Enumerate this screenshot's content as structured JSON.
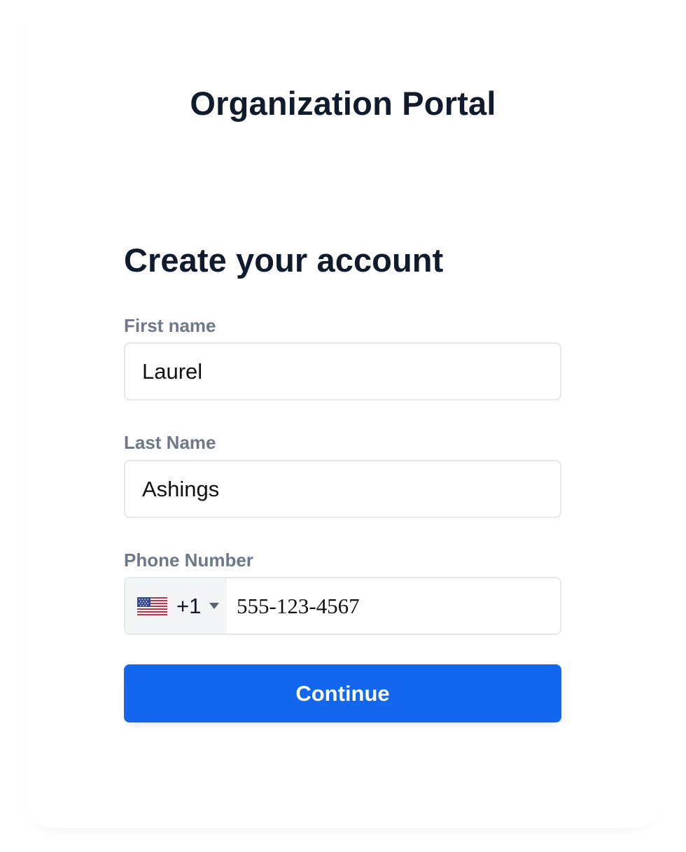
{
  "header": {
    "title": "Organization Portal"
  },
  "form": {
    "heading": "Create your account",
    "first_name": {
      "label": "First name",
      "value": "Laurel"
    },
    "last_name": {
      "label": "Last Name",
      "value": "Ashings"
    },
    "phone": {
      "label": "Phone Number",
      "country_icon": "us-flag-icon",
      "dial_code": "+1",
      "value": "555-123-4567"
    },
    "continue_label": "Continue"
  },
  "colors": {
    "primary": "#1366ee",
    "heading_text": "#101b2e",
    "label_text": "#6e7888",
    "input_border": "#e6e8ec"
  }
}
